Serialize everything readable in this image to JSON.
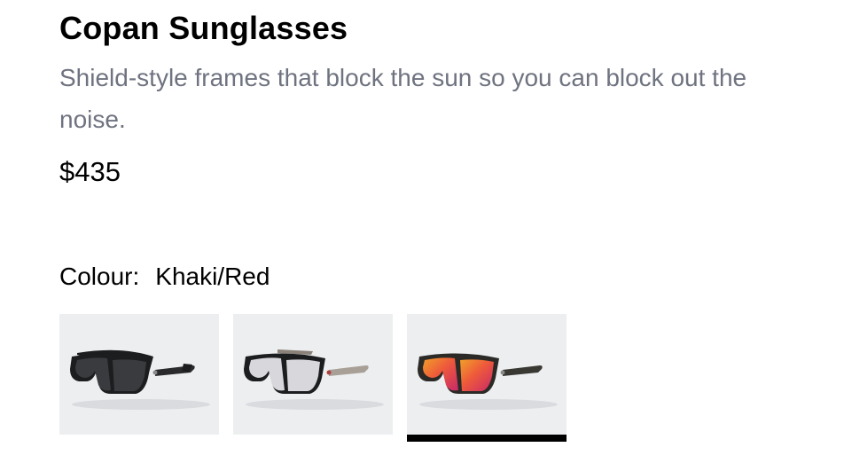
{
  "product": {
    "title": "Copan Sunglasses",
    "description": "Shield-style frames that block the sun so you can block out the noise.",
    "price": "$435"
  },
  "colour": {
    "label": "Colour:",
    "selected": "Khaki/Red",
    "options": [
      {
        "icon": "sunglasses-black-icon",
        "frame_color": "#1c1d1f",
        "lens_color": "#3a3b3e",
        "selected": false
      },
      {
        "icon": "sunglasses-silver-icon",
        "frame_color": "#1c1d1f",
        "lens_color": "#d8d8dc",
        "selected": false
      },
      {
        "icon": "sunglasses-khaki-red-icon",
        "frame_color": "#2b2a26",
        "lens_color": "#e8493b",
        "selected": true
      }
    ]
  }
}
